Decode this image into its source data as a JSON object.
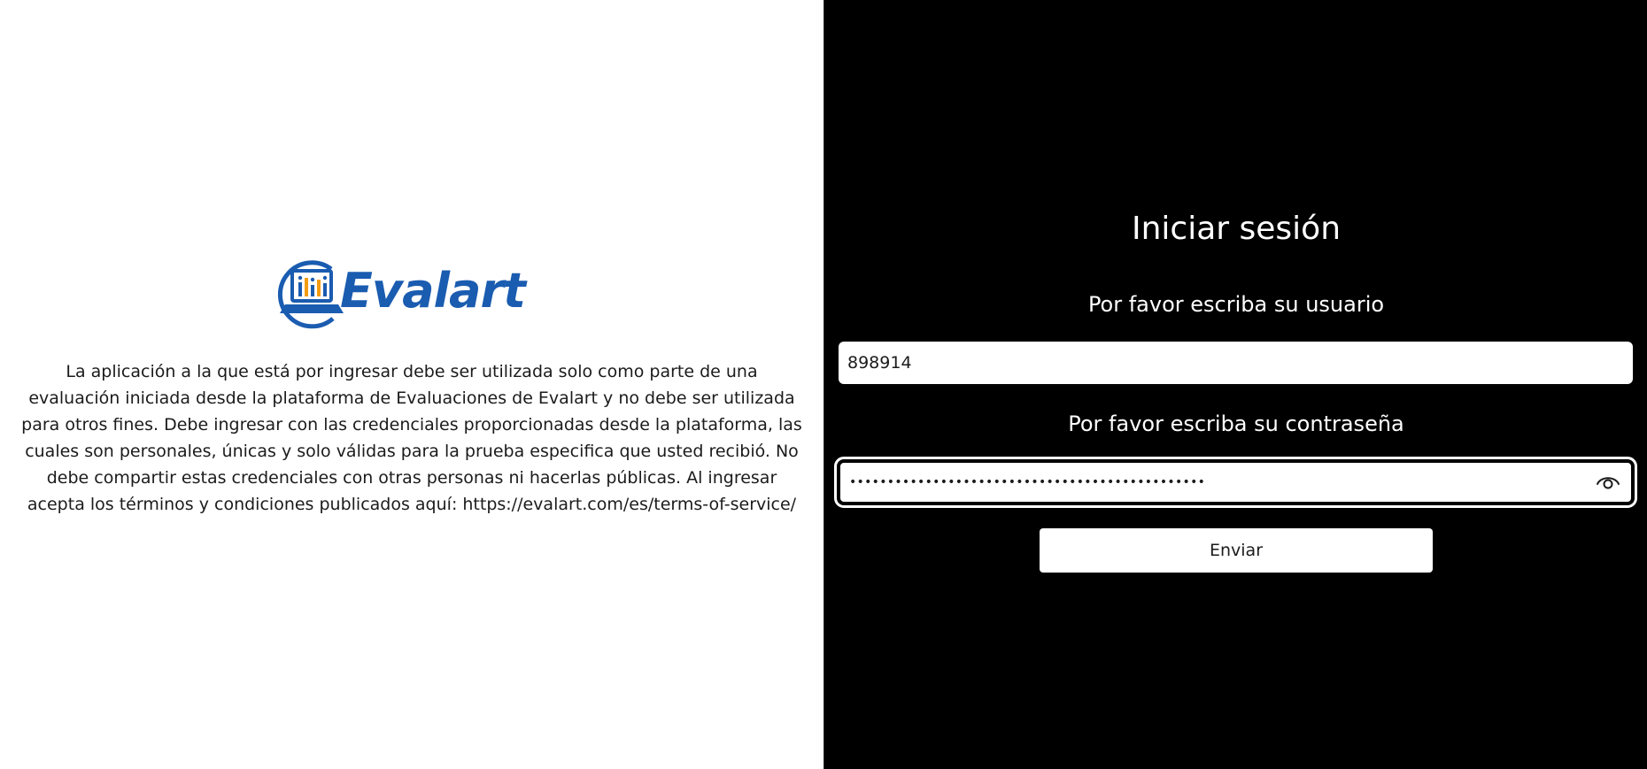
{
  "brand": {
    "logo_text": "Evalart",
    "primary_color": "#1a5cb0",
    "accent_color": "#f39c12"
  },
  "disclaimer": {
    "text": "La aplicación a la que está por ingresar debe ser utilizada solo como parte de una evaluación iniciada desde la plataforma de Evaluaciones de Evalart y no debe ser utilizada para otros fines. Debe ingresar con las credenciales proporcionadas desde la plataforma, las cuales son personales, únicas y solo válidas para la prueba especifica que usted recibió. No debe compartir estas credenciales con otras personas ni hacerlas públicas. Al ingresar acepta los términos y condiciones publicados aquí: https://evalart.com/es/terms-of-service/"
  },
  "login": {
    "title": "Iniciar sesión",
    "username_label": "Por favor escriba su usuario",
    "username_value": "898914",
    "password_label": "Por favor escriba su contraseña",
    "password_masked": "•••••••••••••••••••••••••••••••••••••••••••••••",
    "show_password_icon": "eye-icon",
    "submit_label": "Enviar"
  }
}
